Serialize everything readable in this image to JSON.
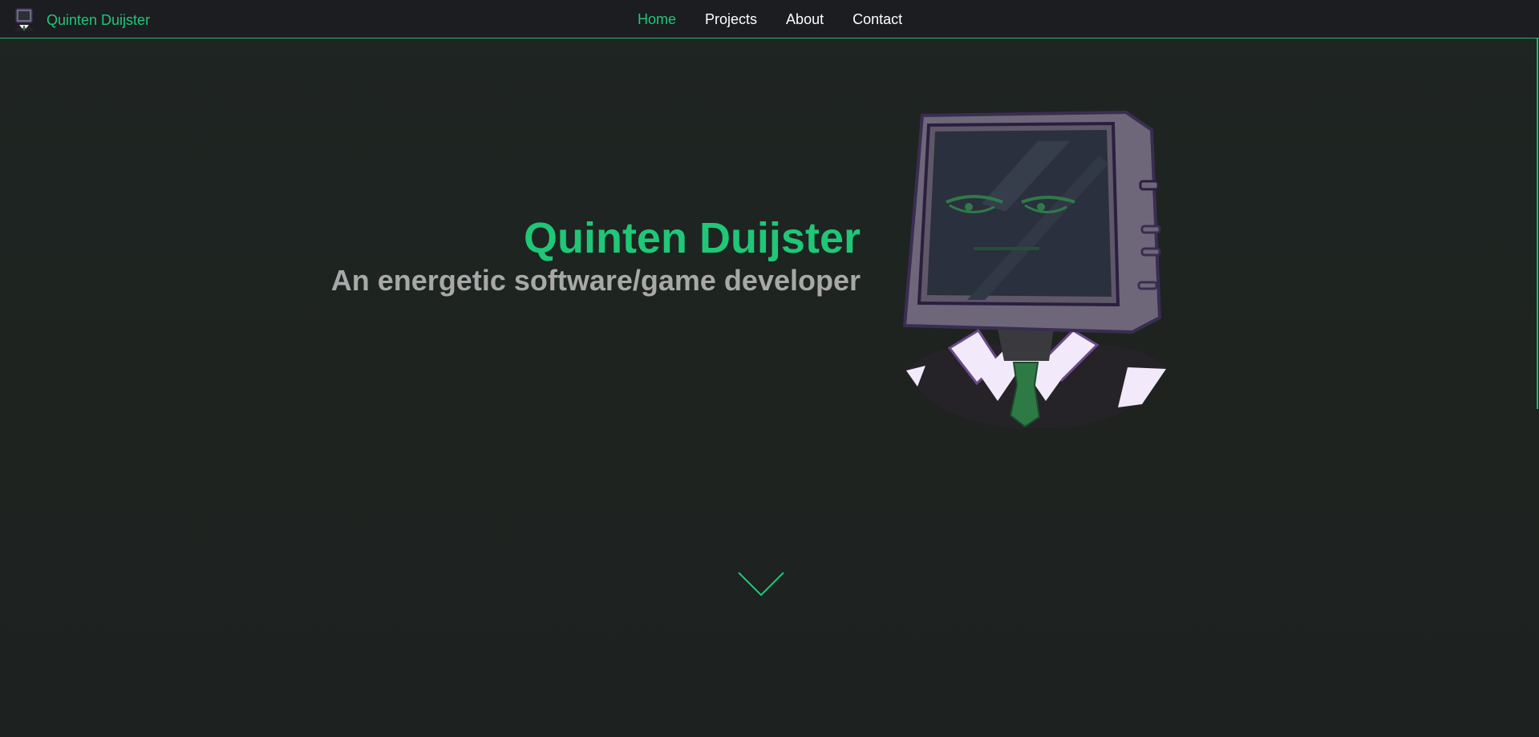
{
  "nav": {
    "brand_name": "Quinten Duijster",
    "links": [
      {
        "label": "Home",
        "active": true
      },
      {
        "label": "Projects",
        "active": false
      },
      {
        "label": "About",
        "active": false
      },
      {
        "label": "Contact",
        "active": false
      }
    ]
  },
  "hero": {
    "title": "Quinten Duijster",
    "subtitle": "An energetic software/game developer",
    "avatar_icon": "tv-head-avatar-icon",
    "scroll_icon": "chevron-down-icon"
  },
  "colors": {
    "accent": "#1fc777",
    "nav_bg": "#1b1d20",
    "page_bg": "#1e2421",
    "subtitle": "#a8a8a8"
  }
}
